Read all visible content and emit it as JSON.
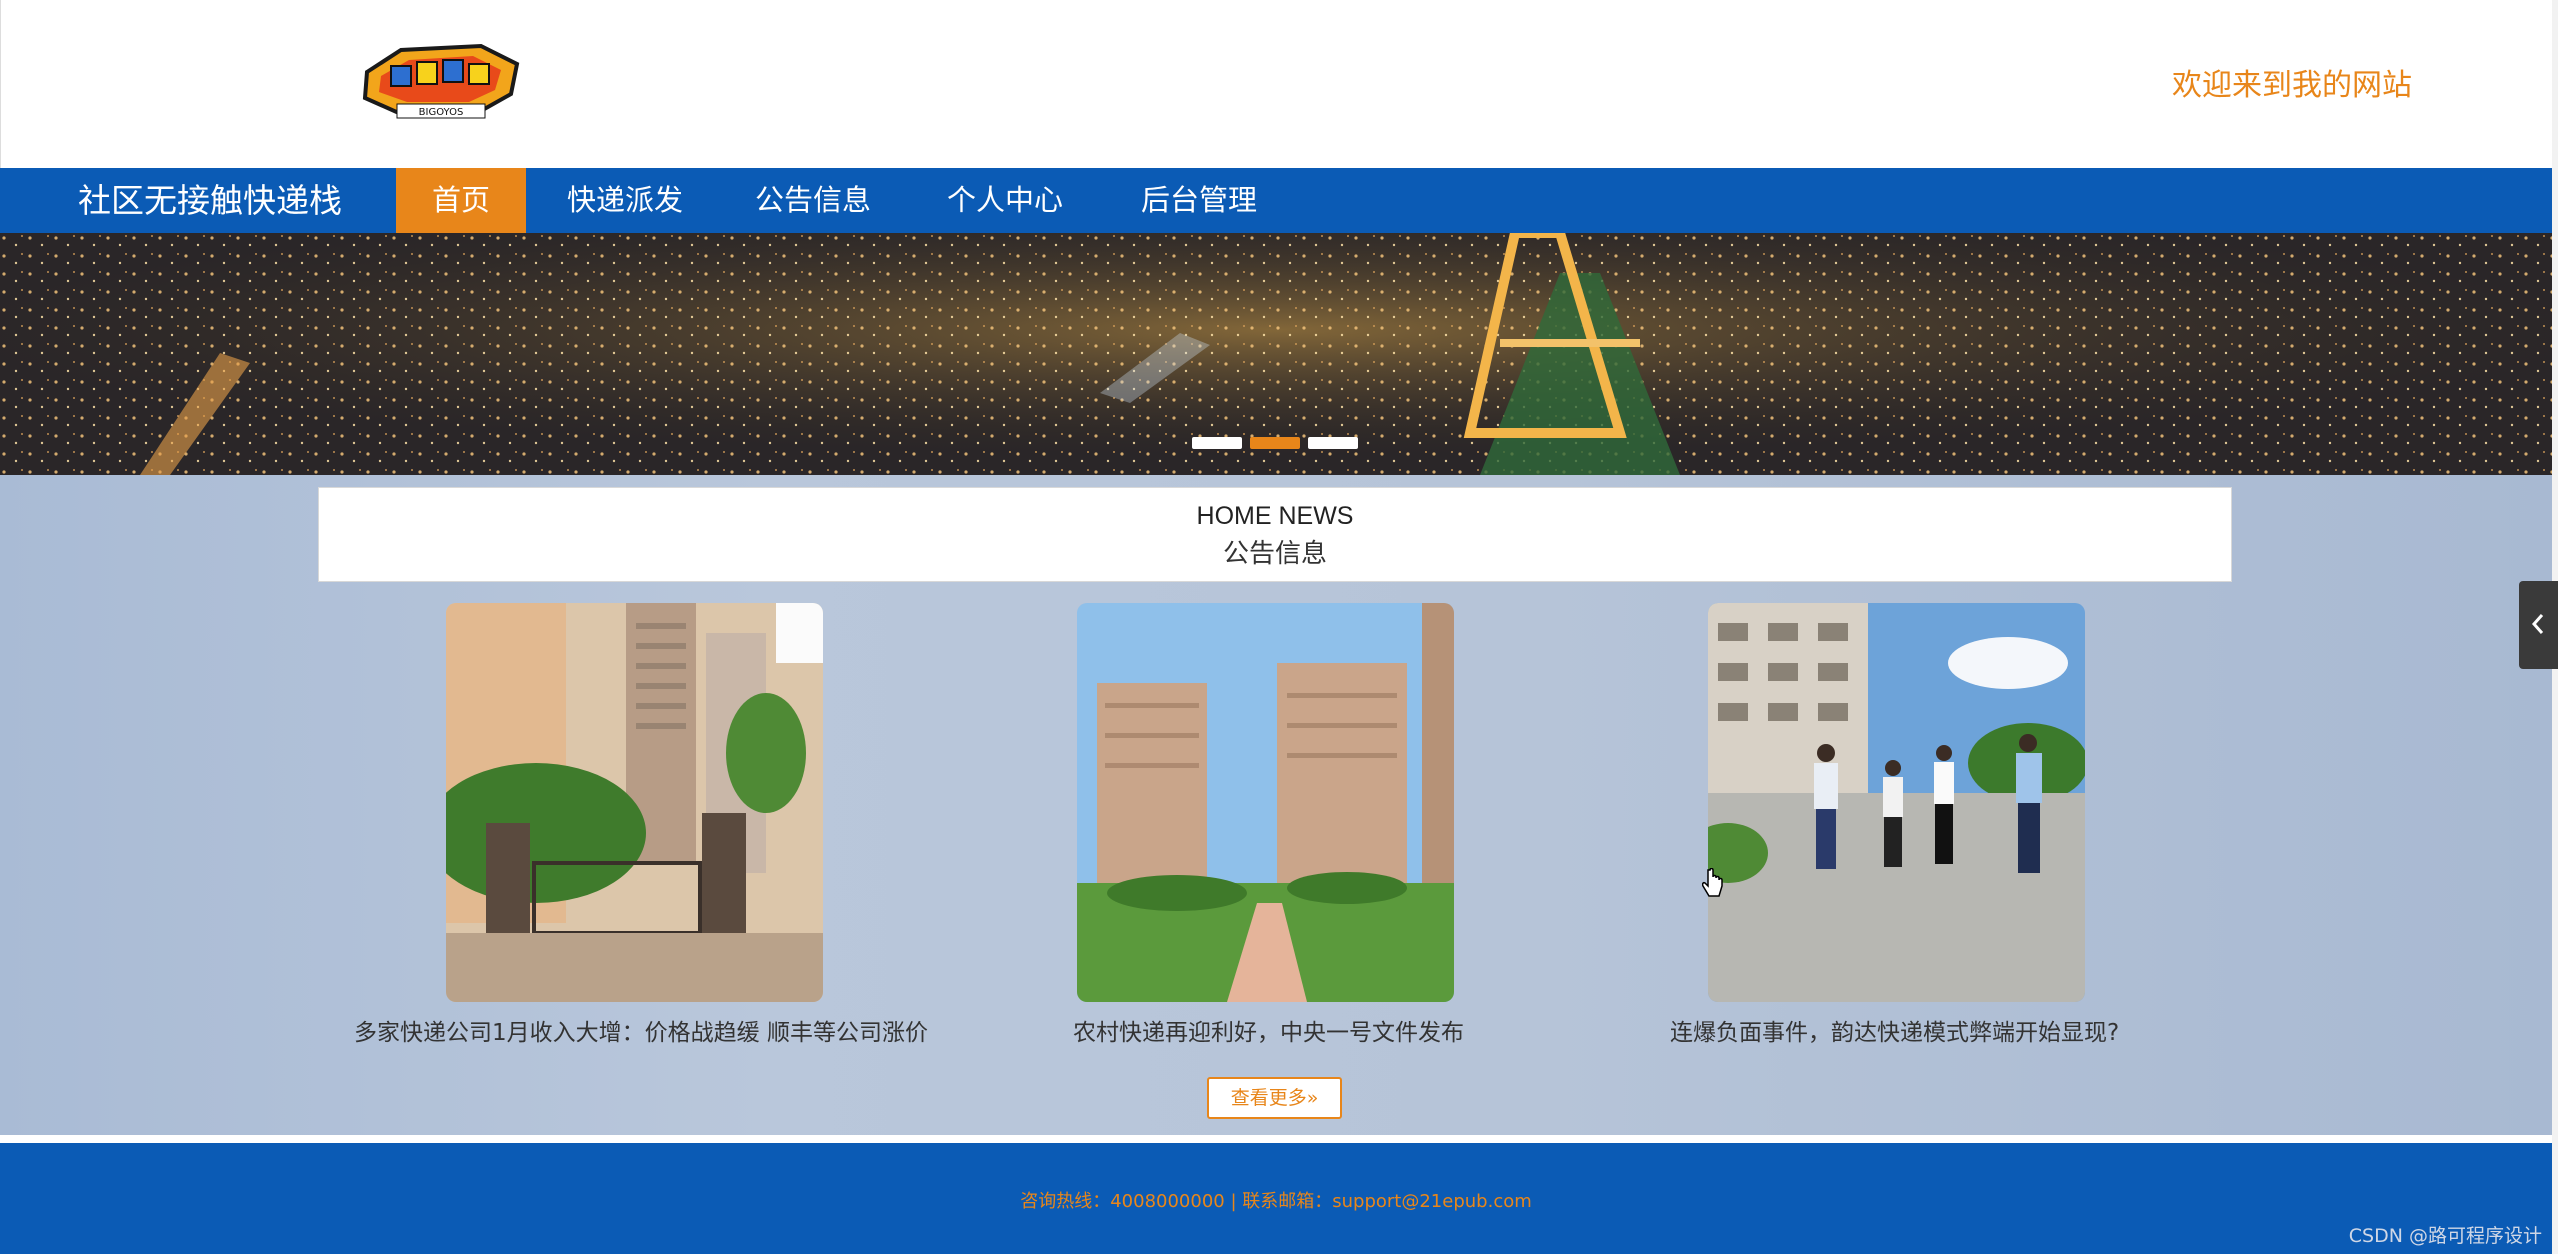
{
  "header": {
    "logo_alt": "BIGOYOS",
    "welcome": "欢迎来到我的网站"
  },
  "nav": {
    "brand": "社区无接触快递栈",
    "items": [
      {
        "label": "首页",
        "active": true
      },
      {
        "label": "快递派发",
        "active": false
      },
      {
        "label": "公告信息",
        "active": false
      },
      {
        "label": "个人中心",
        "active": false
      },
      {
        "label": "后台管理",
        "active": false
      }
    ]
  },
  "banner": {
    "slides": 3,
    "active_index": 1
  },
  "news": {
    "title_en": "HOME NEWS",
    "title_cn": "公告信息",
    "items": [
      {
        "caption": "多家快递公司1月收入大增：价格战趋缓 顺丰等公司涨价",
        "image": "apartment-gate"
      },
      {
        "caption": "农村快递再迎利好，中央一号文件发布",
        "image": "residential-garden"
      },
      {
        "caption": "连爆负面事件，韵达快递模式弊端开始显现?",
        "image": "people-walking"
      }
    ],
    "more_button": "查看更多»"
  },
  "footer": {
    "contact": "咨询热线：4008000000 | 联系邮箱：support@21epub.com",
    "watermark": "CSDN @路可程序设计"
  },
  "colors": {
    "primary": "#0b5bb5",
    "accent": "#e8861a"
  }
}
